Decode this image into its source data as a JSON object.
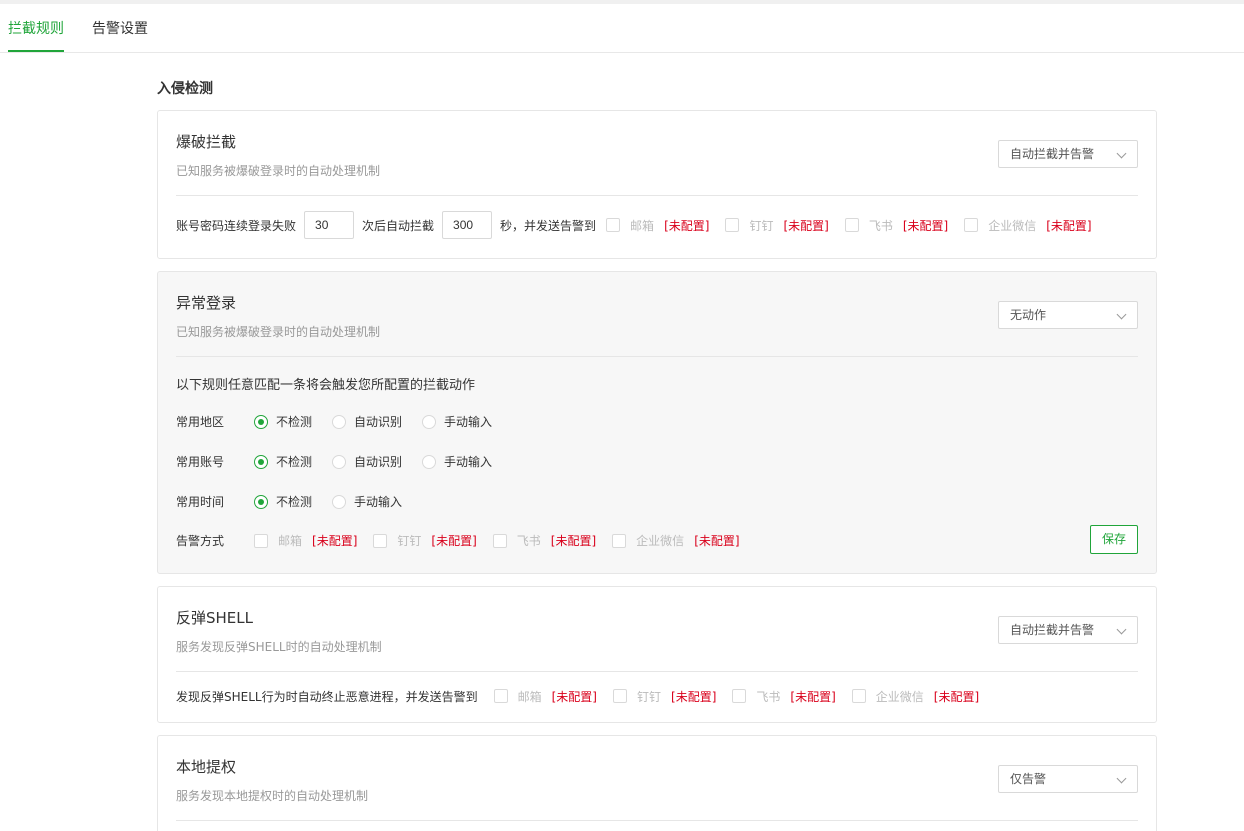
{
  "tabs": [
    {
      "label": "拦截规则",
      "active": true
    },
    {
      "label": "告警设置",
      "active": false
    }
  ],
  "section_title": "入侵检测",
  "channels_unconfigured": "[未配置]",
  "channel_names": [
    "邮箱",
    "钉钉",
    "飞书",
    "企业微信"
  ],
  "brute": {
    "title": "爆破拦截",
    "desc": "已知服务被爆破登录时的自动处理机制",
    "action": "自动拦截并告警",
    "rule_prefix": "账号密码连续登录失败",
    "fail_count": "30",
    "rule_mid": "次后自动拦截",
    "block_seconds": "300",
    "rule_suffix": "秒，并发送告警到"
  },
  "abnormal": {
    "title": "异常登录",
    "desc": "已知服务被爆破登录时的自动处理机制",
    "action": "无动作",
    "rule_hint": "以下规则任意匹配一条将会触发您所配置的拦截动作",
    "rows": [
      {
        "label": "常用地区",
        "options": [
          "不检测",
          "自动识别",
          "手动输入"
        ],
        "selected": 0
      },
      {
        "label": "常用账号",
        "options": [
          "不检测",
          "自动识别",
          "手动输入"
        ],
        "selected": 0
      },
      {
        "label": "常用时间",
        "options": [
          "不检测",
          "手动输入"
        ],
        "selected": 0
      }
    ],
    "alert_label": "告警方式",
    "save_label": "保存"
  },
  "shell": {
    "title": "反弹SHELL",
    "desc": "服务发现反弹SHELL时的自动处理机制",
    "action": "自动拦截并告警",
    "rule_text": "发现反弹SHELL行为时自动终止恶意进程，并发送告警到"
  },
  "privesc": {
    "title": "本地提权",
    "desc": "服务发现本地提权时的自动处理机制",
    "action": "仅告警"
  },
  "colors": {
    "accent": "#20a53a",
    "warning": "#d9001b"
  }
}
